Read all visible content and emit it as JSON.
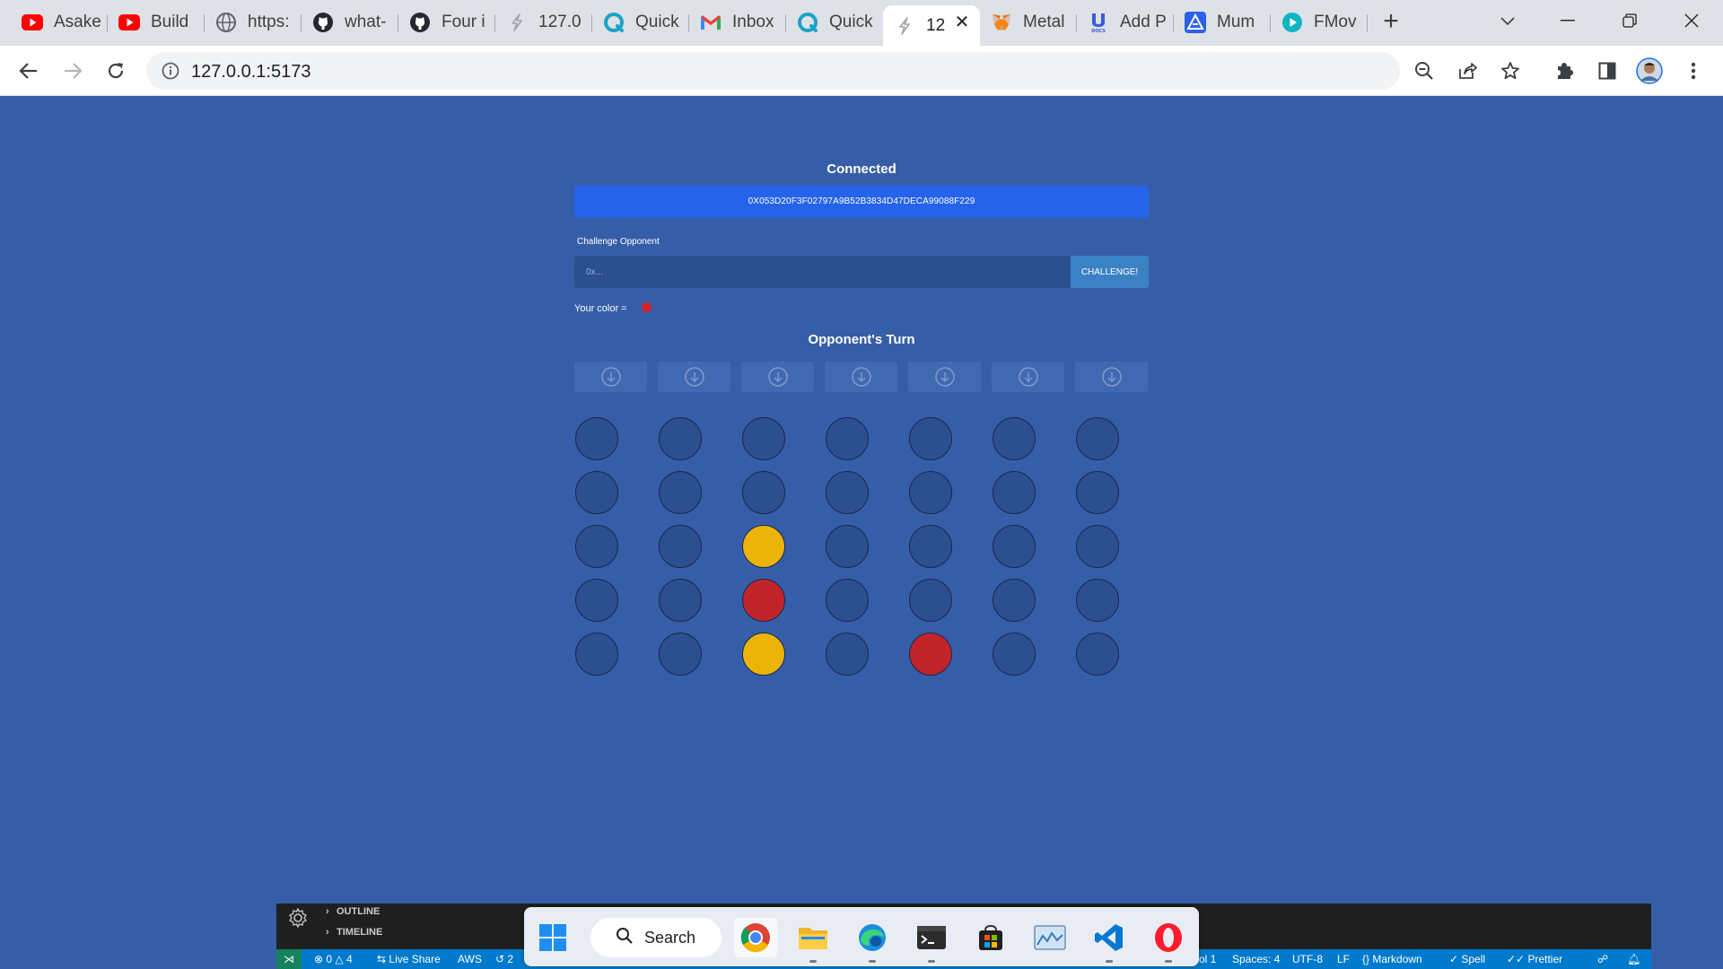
{
  "browser": {
    "tabs": [
      {
        "title": "Asake",
        "icon": "youtube-icon"
      },
      {
        "title": "Build",
        "icon": "youtube-icon"
      },
      {
        "title": "https:",
        "icon": "globe-icon"
      },
      {
        "title": "what-",
        "icon": "github-icon"
      },
      {
        "title": "Four i",
        "icon": "github-icon"
      },
      {
        "title": "127.0",
        "icon": "vite-icon"
      },
      {
        "title": "Quick",
        "icon": "quicknode-icon"
      },
      {
        "title": "Inbox",
        "icon": "gmail-icon"
      },
      {
        "title": "Quick",
        "icon": "quicknode-icon"
      },
      {
        "title": "12",
        "icon": "vite-icon",
        "active": true
      },
      {
        "title": "Metal",
        "icon": "metamask-icon"
      },
      {
        "title": "Add P",
        "icon": "docs-icon"
      },
      {
        "title": "Mum",
        "icon": "alchemy-icon"
      },
      {
        "title": "FMov",
        "icon": "play-icon"
      }
    ],
    "address": {
      "url": "127.0.0.1:5173"
    }
  },
  "app": {
    "wallet_status": "Connected",
    "wallet_address": "0X053D20F3F02797A9B52B3834D47DECA99088F229",
    "challenge_label": "Challenge Opponent",
    "challenge_placeholder": "0x...",
    "challenge_button": "CHALLENGE!",
    "your_color_label": "Your color =",
    "your_color": "#d0222a",
    "turn_status": "Opponent's Turn",
    "board": {
      "columns": 7,
      "rows": 5,
      "cells": [
        [
          "empty",
          "empty",
          "empty",
          "empty",
          "empty",
          "empty",
          "empty"
        ],
        [
          "empty",
          "empty",
          "empty",
          "empty",
          "empty",
          "empty",
          "empty"
        ],
        [
          "empty",
          "empty",
          "yellow",
          "empty",
          "empty",
          "empty",
          "empty"
        ],
        [
          "empty",
          "empty",
          "red",
          "empty",
          "empty",
          "empty",
          "empty"
        ],
        [
          "empty",
          "empty",
          "yellow",
          "empty",
          "red",
          "empty",
          "empty"
        ]
      ]
    }
  },
  "vscode": {
    "sections": [
      "OUTLINE",
      "TIMELINE"
    ],
    "status_left": {
      "remote_icon": "remote-icon",
      "problems": "0",
      "warnings": "4",
      "live_share": "Live Share",
      "aws": "AWS",
      "history": "2"
    },
    "status_right": {
      "position": "ol 1",
      "spaces": "Spaces: 4",
      "encoding": "UTF-8",
      "eol": "LF",
      "language": "Markdown",
      "spell": "Spell",
      "prettier": "Prettier"
    }
  },
  "taskbar": {
    "search_label": "Search",
    "apps": [
      "chrome-icon",
      "file-explorer-icon",
      "edge-icon",
      "terminal-icon",
      "store-icon",
      "photos-icon",
      "vscode-icon",
      "opera-icon"
    ]
  }
}
